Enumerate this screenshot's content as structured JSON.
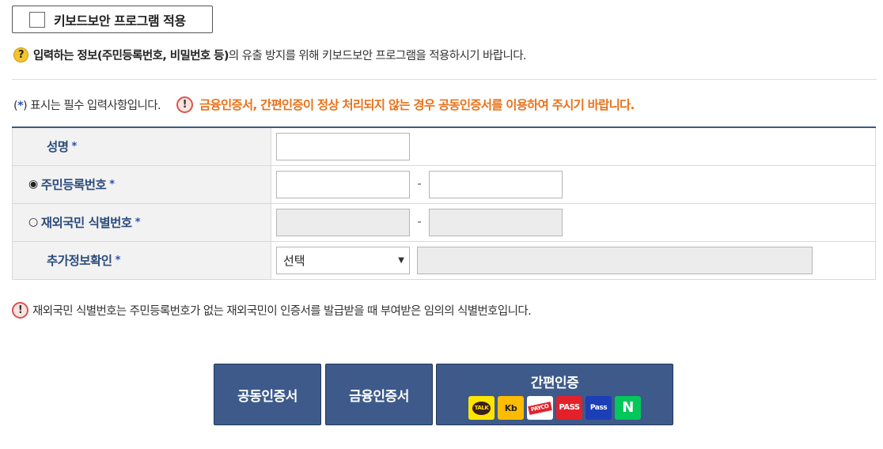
{
  "keyboard_security": {
    "label": "키보드보안 프로그램 적용"
  },
  "notice_security": {
    "icon": "question-icon",
    "bold": "입력하는 정보(주민등록번호, 비밀번호 등)",
    "text": "의 유출 방지를 위해 키보드보안 프로그램을 적용하시기 바랍니다."
  },
  "required_note": {
    "open": "(",
    "star": "*",
    "close": ") 표시는 필수 입력사항입니다."
  },
  "warning_orange": "금융인증서, 간편인증이 정상 처리되지 않는 경우 공동인증서를 이용하여 주시기 바랍니다.",
  "form": {
    "name_label": "성명",
    "rrn_label": "주민등록번호",
    "rrn_selected": true,
    "foreign_label": "재외국민 식별번호",
    "foreign_selected": false,
    "extra_label": "추가정보확인",
    "extra_select_value": "선택",
    "dash": "-",
    "star": "*"
  },
  "notice_foreign": "재외국민 식별번호는 주민등록번호가 없는 재외국민이 인증서를 발급받을 때 부여받은 임의의 식별번호입니다.",
  "buttons": {
    "joint_cert": "공동인증서",
    "finance_cert": "금융인증서",
    "simple_auth": "간편인증",
    "logos": {
      "kakao": "TALK",
      "kb": "Kb",
      "payco": "PAYCO",
      "pass": "PASS",
      "samsung_pass": "Pass",
      "naver": "N"
    }
  },
  "colors": {
    "header_blue": "#2c4c7c",
    "orange": "#e8731b",
    "button_bg": "#3d5a8a"
  }
}
